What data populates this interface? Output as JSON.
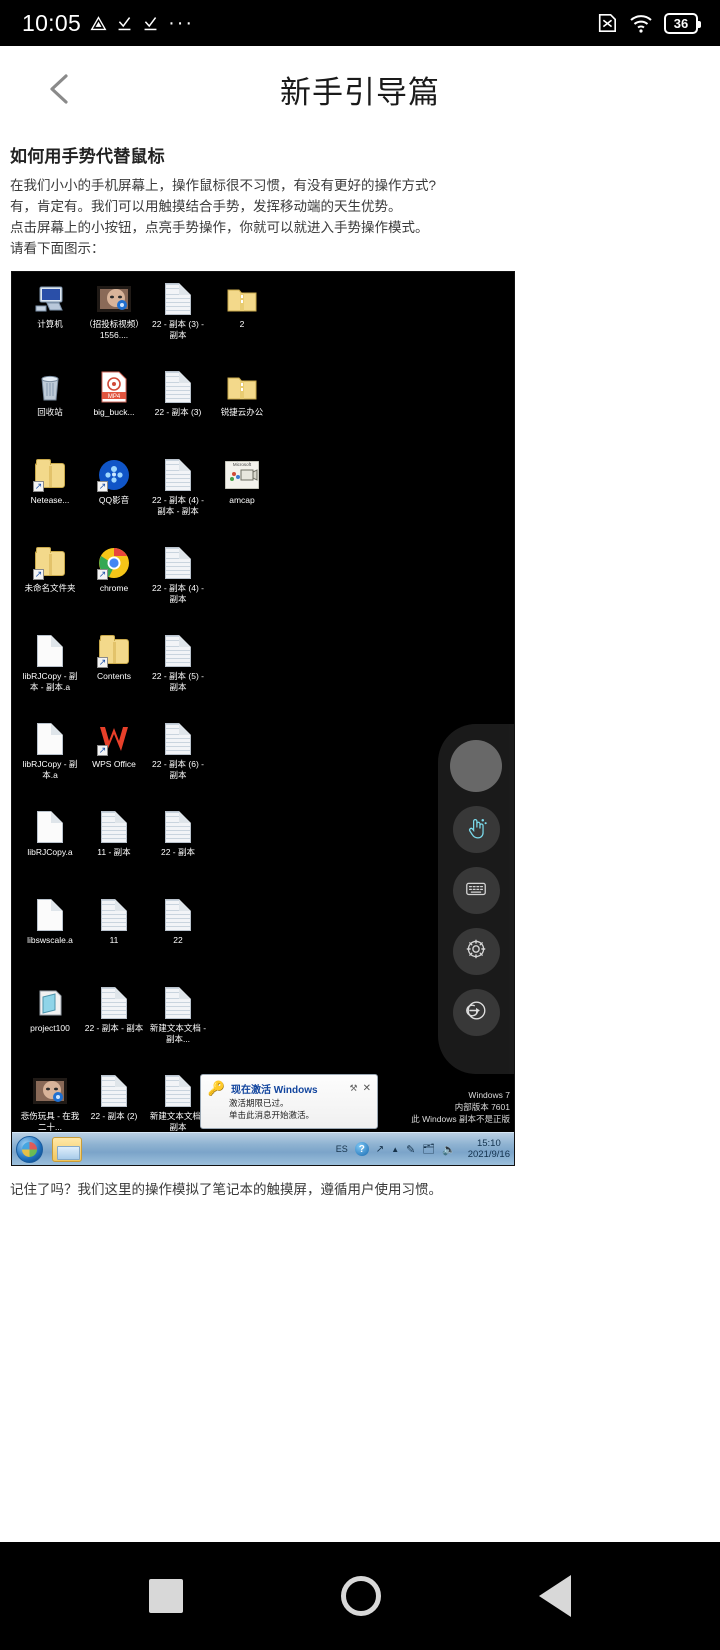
{
  "statusbar": {
    "time": "10:05",
    "icons": [
      "drive-triangle-icon",
      "download-check-icon",
      "download-check-icon",
      "more-dots-icon"
    ],
    "more": "···",
    "right_icons": [
      "no-sim-icon",
      "wifi-icon"
    ],
    "battery": "36"
  },
  "titlebar": {
    "back": "‹",
    "title": "新手引导篇"
  },
  "article": {
    "heading": "如何用手势代替鼠标",
    "paragraphs": [
      "在我们小小的手机屏幕上，操作鼠标很不习惯，有没有更好的操作方式?",
      "有，肯定有。我们可以用触摸结合手势，发挥移动端的天生优势。",
      "点击屏幕上的小按钮，点亮手势操作，你就可以就进入手势操作模式。",
      "请看下面图示："
    ],
    "footer": "记住了吗？我们这里的操作模拟了笔记本的触摸屏，遵循用户使用习惯。"
  },
  "screenshot": {
    "desktop_icons": [
      {
        "label": "计算机",
        "icon": "computer-icon"
      },
      {
        "label": "（招投标视频）1556....",
        "icon": "video-thumbnail-icon"
      },
      {
        "label": "22 - 副本 (3) - 副本",
        "icon": "text-document-icon"
      },
      {
        "label": "2",
        "icon": "zip-folder-icon"
      },
      {
        "label": "回收站",
        "icon": "recycle-bin-icon"
      },
      {
        "label": "big_buck...",
        "icon": "mp4-file-icon"
      },
      {
        "label": "22 - 副本 (3)",
        "icon": "text-document-icon"
      },
      {
        "label": "锐捷云办公",
        "icon": "zip-folder-icon"
      },
      {
        "label": "Netease...",
        "icon": "folder-icon"
      },
      {
        "label": "QQ影音",
        "icon": "qq-player-icon"
      },
      {
        "label": "22 - 副本 (4) - 副本 - 副本",
        "icon": "text-document-icon"
      },
      {
        "label": "amcap",
        "icon": "amcap-icon"
      },
      {
        "label": "未命名文件夹",
        "icon": "folder-icon"
      },
      {
        "label": "chrome",
        "icon": "chrome-icon"
      },
      {
        "label": "22 - 副本 (4) - 副本",
        "icon": "text-document-icon"
      },
      {
        "label": "",
        "icon": "none"
      },
      {
        "label": "libRJCopy - 副本 - 副本.a",
        "icon": "blank-document-icon"
      },
      {
        "label": "Contents",
        "icon": "folder-icon"
      },
      {
        "label": "22 - 副本 (5) - 副本",
        "icon": "text-document-icon"
      },
      {
        "label": "",
        "icon": "none"
      },
      {
        "label": "libRJCopy - 副本.a",
        "icon": "blank-document-icon"
      },
      {
        "label": "WPS Office",
        "icon": "wps-office-icon"
      },
      {
        "label": "22 - 副本 (6) - 副本",
        "icon": "text-document-icon"
      },
      {
        "label": "",
        "icon": "none"
      },
      {
        "label": "libRJCopy.a",
        "icon": "blank-document-icon"
      },
      {
        "label": "11 - 副本",
        "icon": "text-document-icon"
      },
      {
        "label": "22 - 副本",
        "icon": "text-document-icon"
      },
      {
        "label": "",
        "icon": "none"
      },
      {
        "label": "libswscale.a",
        "icon": "blank-document-icon"
      },
      {
        "label": "11",
        "icon": "text-document-icon"
      },
      {
        "label": "22",
        "icon": "text-document-icon"
      },
      {
        "label": "",
        "icon": "none"
      },
      {
        "label": "project100",
        "icon": "project-file-icon"
      },
      {
        "label": "22 - 副本 - 副本",
        "icon": "text-document-icon"
      },
      {
        "label": "新建文本文档 - 副本...",
        "icon": "text-document-icon"
      },
      {
        "label": "",
        "icon": "none"
      },
      {
        "label": "悲伤玩具 - 在我二十...",
        "icon": "video-thumbnail-icon"
      },
      {
        "label": "22 - 副本 (2)",
        "icon": "text-document-icon"
      },
      {
        "label": "新建文本文档 - 副本",
        "icon": "text-document-icon"
      },
      {
        "label": "",
        "icon": "none"
      }
    ],
    "popup": {
      "icon": "key-icon",
      "title": "现在激活 Windows",
      "wrench": "⚒",
      "close": "✕",
      "line1": "激活期限已过。",
      "line2": "单击此消息开始激活。"
    },
    "watermark": {
      "line1": "Windows 7",
      "line2": "内部版本 7601",
      "line3": "此 Windows 副本不是正版"
    },
    "taskbar": {
      "start": "start-orb-icon",
      "explorer": "explorer-icon",
      "lang": "ES",
      "help": "?",
      "time": "15:10",
      "date": "2021/9/16"
    },
    "dock": {
      "buttons": [
        {
          "name": "dock-home-button",
          "icon": "filled-circle-icon"
        },
        {
          "name": "dock-gesture-button",
          "icon": "hand-touch-icon"
        },
        {
          "name": "dock-keyboard-button",
          "icon": "keyboard-icon"
        },
        {
          "name": "dock-settings-button",
          "icon": "gear-icon"
        },
        {
          "name": "dock-exit-button",
          "icon": "exit-arrow-icon"
        }
      ]
    }
  },
  "navbar": {
    "recents": "square-icon",
    "home": "circle-icon",
    "back": "triangle-back-icon"
  }
}
